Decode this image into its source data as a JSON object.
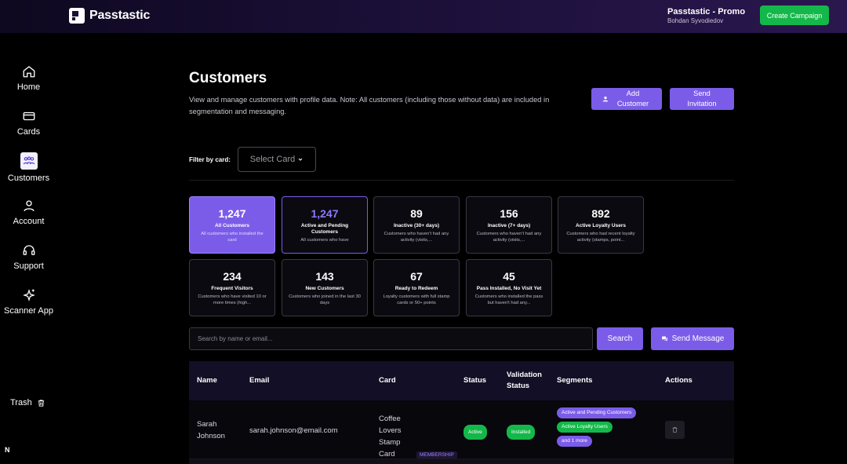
{
  "header": {
    "brand": "Passtastic",
    "account_name": "Passtastic - Promo",
    "account_user": "Bohdan Syvodiedov",
    "create_campaign": "Create Campaign"
  },
  "sidebar": {
    "items": [
      {
        "label": "Home",
        "icon": "home-icon"
      },
      {
        "label": "Cards",
        "icon": "card-icon"
      },
      {
        "label": "Customers",
        "icon": "customers-icon"
      },
      {
        "label": "Account",
        "icon": "user-icon"
      },
      {
        "label": "Support",
        "icon": "headset-icon"
      },
      {
        "label": "Scanner App",
        "icon": "sparkle-icon"
      }
    ],
    "trash": "Trash",
    "n_badge": "N"
  },
  "page": {
    "title": "Customers",
    "description": "View and manage customers with profile data. Note: All customers (including those without data) are included in segmentation and messaging.",
    "add_customer": "Add Customer",
    "send_invitation": "Send Invitation",
    "filter_label": "Filter by card:",
    "select_card": "Select Card"
  },
  "stats": [
    {
      "value": "1,247",
      "label": "All Customers",
      "desc": "All customers who installed the card"
    },
    {
      "value": "1,247",
      "label": "Active and Pending Customers",
      "desc": "All customers who have"
    },
    {
      "value": "89",
      "label": "Inactive (30+ days)",
      "desc": "Customers who haven't had any activity (visits,..."
    },
    {
      "value": "156",
      "label": "Inactive (7+ days)",
      "desc": "Customers who haven't had any activity (visits,..."
    },
    {
      "value": "892",
      "label": "Active Loyalty Users",
      "desc": "Customers who had recent loyalty activity (stamps, point..."
    },
    {
      "value": "234",
      "label": "Frequent Visitors",
      "desc": "Customers who have visited 10 or more times (high..."
    },
    {
      "value": "143",
      "label": "New Customers",
      "desc": "Customers who joined in the last 30 days"
    },
    {
      "value": "67",
      "label": "Ready to Redeem",
      "desc": "Loyalty customers with full stamp cards or 50+ points"
    },
    {
      "value": "45",
      "label": "Pass Installed, No Visit Yet",
      "desc": "Customers who installed the pass but haven't had any..."
    }
  ],
  "search": {
    "placeholder": "Search by name or email...",
    "search_btn": "Search",
    "send_message": "Send Message"
  },
  "table": {
    "headers": [
      "Name",
      "Email",
      "Card",
      "Status",
      "Validation Status",
      "Segments",
      "Actions"
    ],
    "rows": [
      {
        "name": "Sarah Johnson",
        "email": "sarah.johnson@email.com",
        "card": "Coffee Lovers Stamp Card",
        "card_type": "MEMBERSHIP",
        "status": "Active",
        "validation": "Installed",
        "segments": [
          "Active and Pending Customers",
          "Active Loyalty Users",
          "and 1 more"
        ]
      }
    ]
  },
  "colors": {
    "accent": "#7b5ce8",
    "success": "#14b84a",
    "background": "#000000"
  }
}
